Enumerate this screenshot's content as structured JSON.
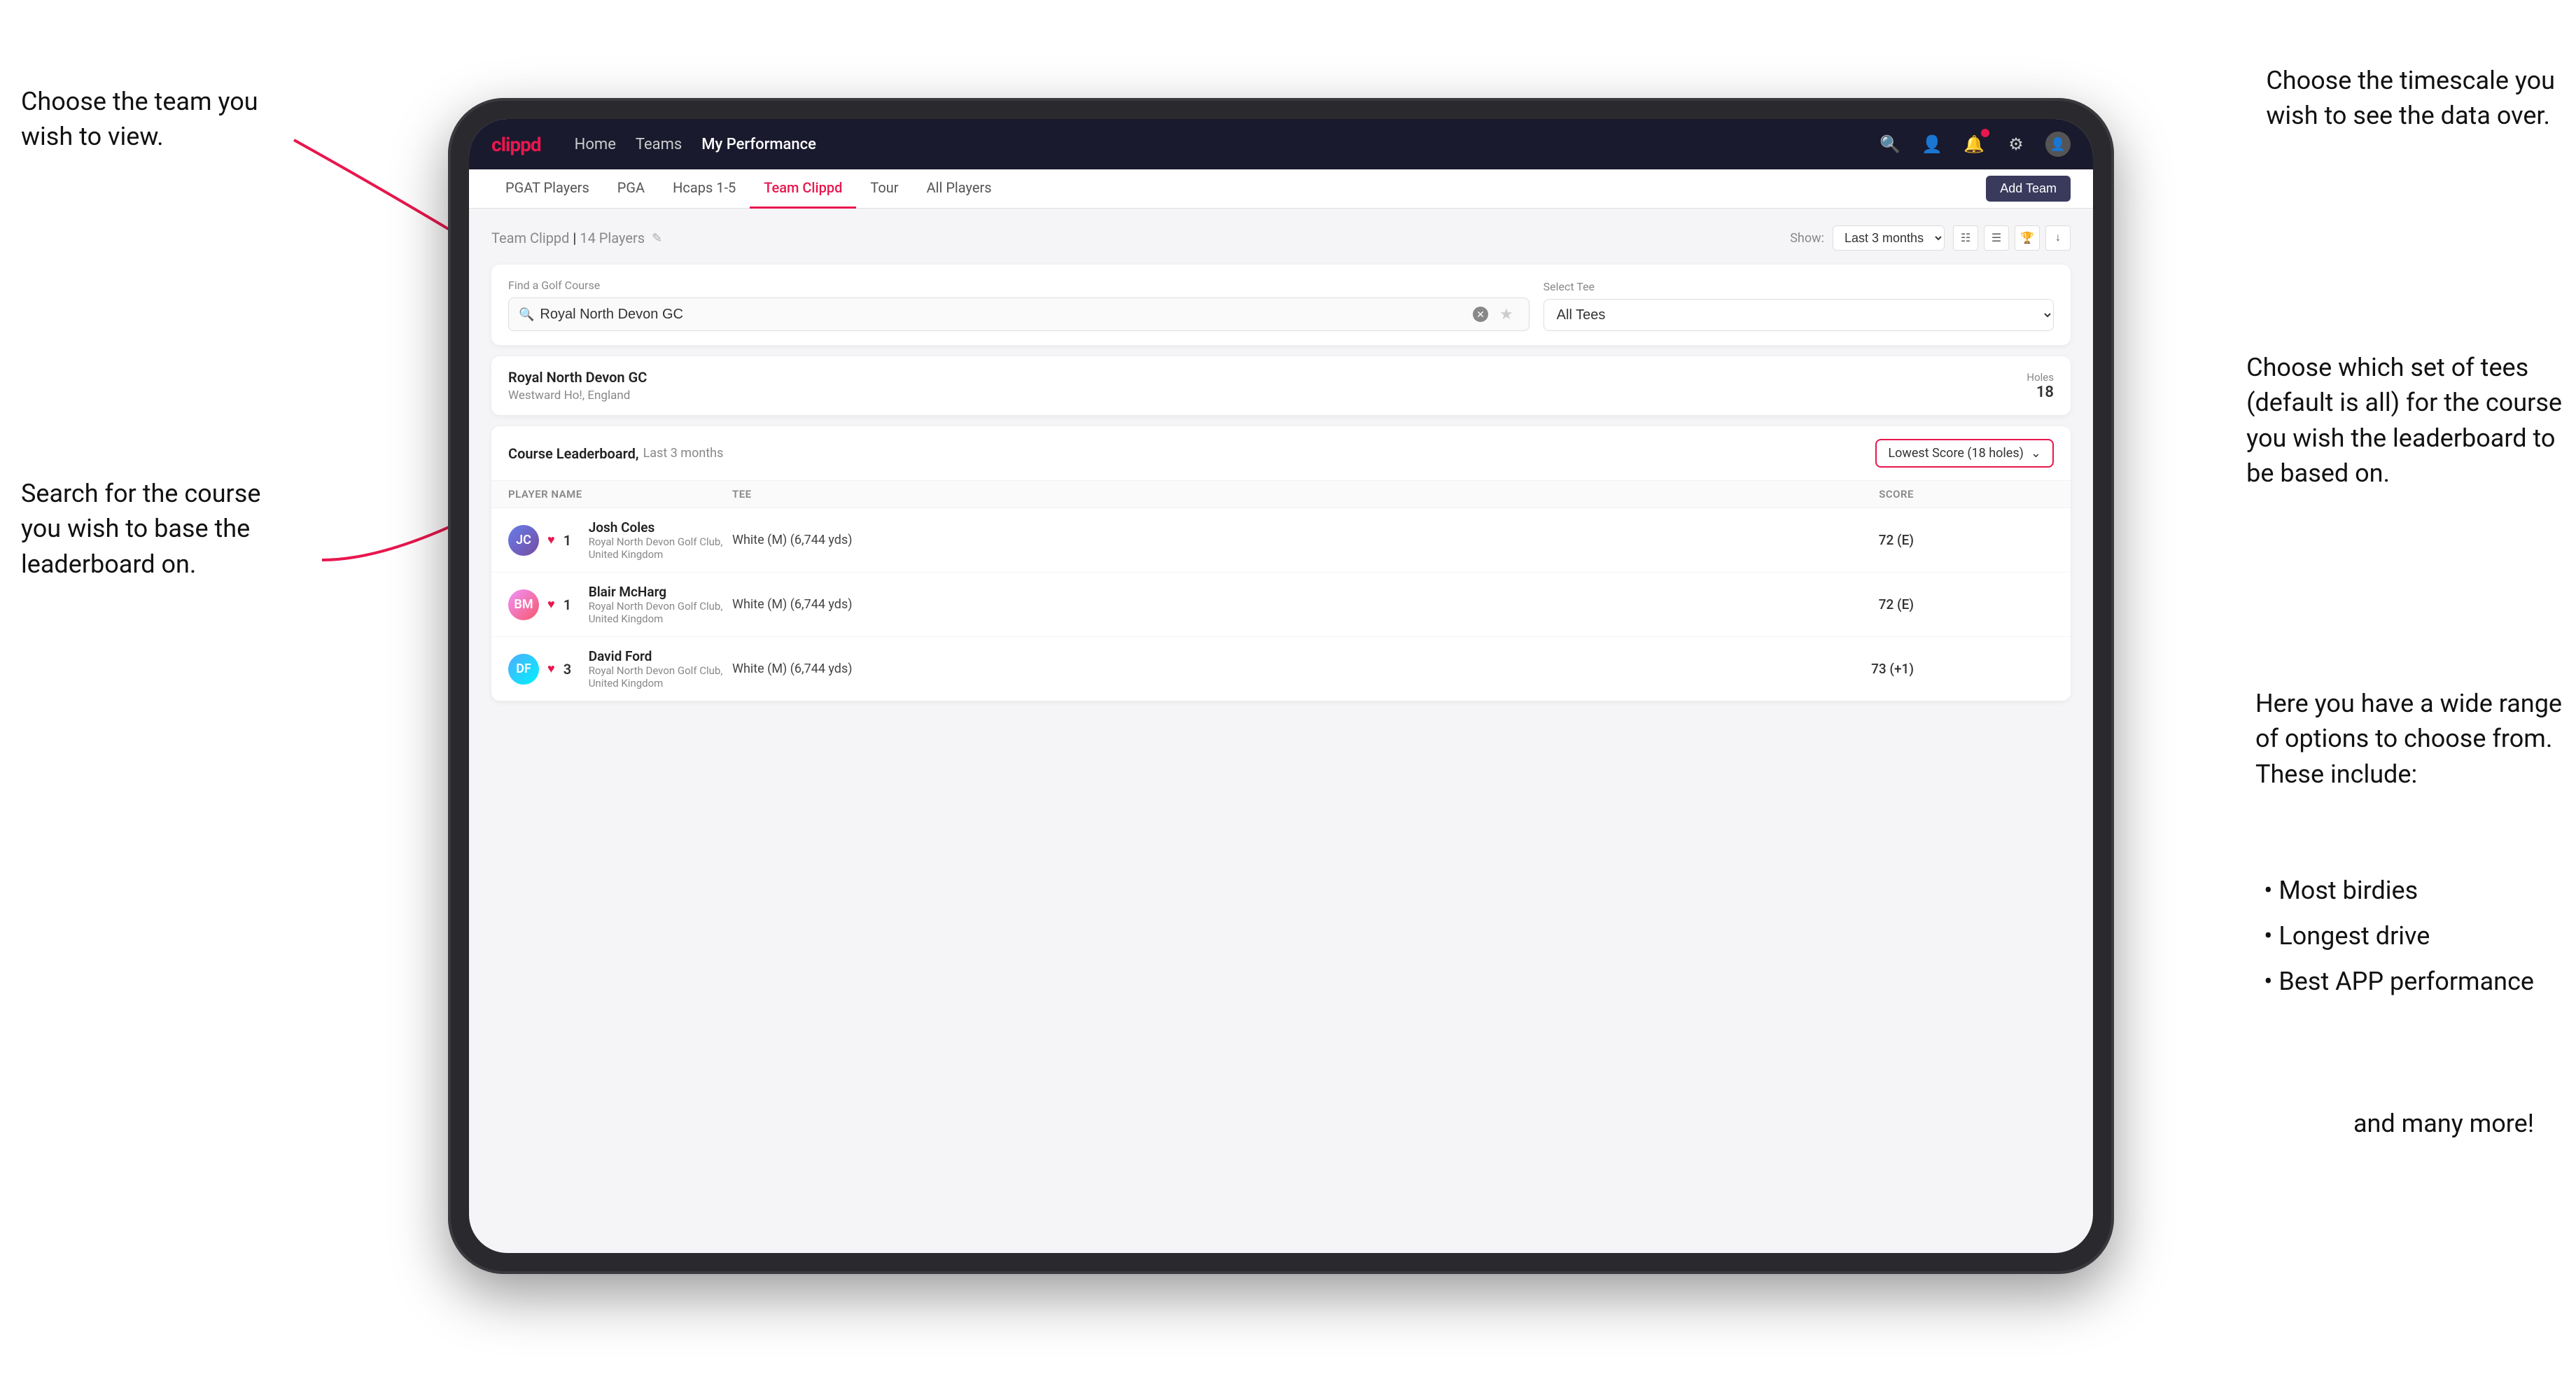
{
  "annotations": {
    "top_left_title": "Choose the team you\nwish to view.",
    "middle_left_title": "Search for the course\nyou wish to base the\nleaderboard on.",
    "top_right_title": "Choose the timescale you\nwish to see the data over.",
    "middle_right_title": "Choose which set of tees\n(default is all) for the course\nyou wish the leaderboard to\nbe based on.",
    "bottom_right_title": "Here you have a wide range\nof options to choose from.\nThese include:",
    "bullets": [
      "Most birdies",
      "Longest drive",
      "Best APP performance"
    ],
    "bottom_right_extra": "and many more!"
  },
  "nav": {
    "logo": "clippd",
    "links": [
      "Home",
      "Teams",
      "My Performance"
    ],
    "active_link": "My Performance"
  },
  "subnav": {
    "items": [
      "PGAT Players",
      "PGA",
      "Hcaps 1-5",
      "Team Clippd",
      "Tour",
      "All Players"
    ],
    "active": "Team Clippd",
    "add_team_label": "Add Team"
  },
  "team_header": {
    "title": "Team Clippd",
    "player_count": "14 Players",
    "show_label": "Show:",
    "show_value": "Last 3 months"
  },
  "search": {
    "label": "Find a Golf Course",
    "placeholder": "Royal North Devon GC",
    "tee_label": "Select Tee",
    "tee_value": "All Tees"
  },
  "course": {
    "name": "Royal North Devon GC",
    "location": "Westward Ho!, England",
    "holes_label": "Holes",
    "holes": "18"
  },
  "leaderboard": {
    "title": "Course Leaderboard,",
    "subtitle": "Last 3 months",
    "score_option": "Lowest Score (18 holes)",
    "columns": [
      "PLAYER NAME",
      "TEE",
      "SCORE"
    ],
    "players": [
      {
        "rank": "1",
        "name": "Josh Coles",
        "club": "Royal North Devon Golf Club, United Kingdom",
        "tee": "White (M) (6,744 yds)",
        "score": "72 (E)",
        "avatar_initials": "JC"
      },
      {
        "rank": "1",
        "name": "Blair McHarg",
        "club": "Royal North Devon Golf Club, United Kingdom",
        "tee": "White (M) (6,744 yds)",
        "score": "72 (E)",
        "avatar_initials": "BM"
      },
      {
        "rank": "3",
        "name": "David Ford",
        "club": "Royal North Devon Golf Club, United Kingdom",
        "tee": "White (M) (6,744 yds)",
        "score": "73 (+1)",
        "avatar_initials": "DF"
      }
    ]
  }
}
